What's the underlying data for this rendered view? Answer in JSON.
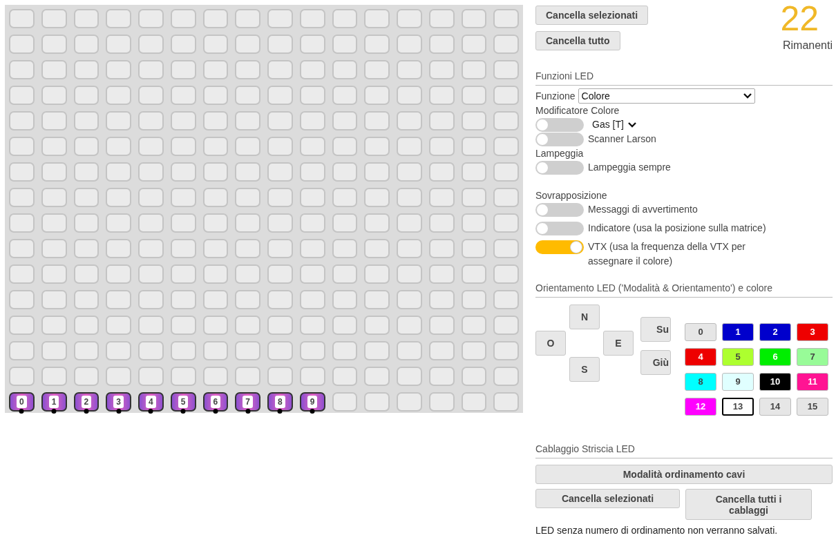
{
  "wired_leds": [
    "0",
    "1",
    "2",
    "3",
    "4",
    "5",
    "6",
    "7",
    "8",
    "9"
  ],
  "top_buttons": [
    "Cancella selezionati",
    "Cancella tutto"
  ],
  "remaining": {
    "count": "22",
    "label": "Rimanenti"
  },
  "functions": {
    "title": "Funzioni LED",
    "function_label": "Funzione",
    "function_value": "Colore",
    "modifier_title": "Modificatore Colore",
    "modifiers": [
      {
        "kind": "select",
        "on": false,
        "label": "Gas [T]"
      },
      {
        "kind": "toggle",
        "on": false,
        "label": "Scanner Larson"
      }
    ],
    "blink_title": "Lampeggia",
    "blink": [
      {
        "on": false,
        "label": "Lampeggia sempre"
      }
    ]
  },
  "overlay": {
    "title": "Sovrapposizione",
    "items": [
      {
        "on": false,
        "label": "Messaggi di avvertimento"
      },
      {
        "on": false,
        "label": "Indicatore (usa la posizione sulla matrice)"
      },
      {
        "on": true,
        "label": "VTX (usa la frequenza della VTX per assegnare il colore)"
      }
    ]
  },
  "orientation": {
    "title": "Orientamento LED ('Modalità & Orientamento') e colore",
    "directions": {
      "north": "N",
      "west": "O",
      "east": "E",
      "south": "S"
    },
    "vertical": [
      "Su",
      "Giù"
    ],
    "colors": [
      {
        "label": "0",
        "color": "#e6e6e6",
        "selected": false
      },
      {
        "label": "1",
        "color": "#0000cc",
        "selected": false
      },
      {
        "label": "2",
        "color": "#0000cc",
        "selected": false
      },
      {
        "label": "3",
        "color": "#ee0000",
        "selected": false
      },
      {
        "label": "4",
        "color": "#ee0000",
        "selected": false
      },
      {
        "label": "5",
        "color": "#adff2f",
        "selected": false
      },
      {
        "label": "6",
        "color": "#00ee00",
        "selected": false
      },
      {
        "label": "7",
        "color": "#98fb98",
        "selected": false
      },
      {
        "label": "8",
        "color": "#00ffff",
        "selected": false
      },
      {
        "label": "9",
        "color": "#e0ffff",
        "selected": false
      },
      {
        "label": "10",
        "color": "#000000",
        "selected": false
      },
      {
        "label": "11",
        "color": "#ff1493",
        "selected": false
      },
      {
        "label": "12",
        "color": "#ff00ff",
        "selected": false
      },
      {
        "label": "13",
        "color": "#ffffff",
        "selected": true
      },
      {
        "label": "14",
        "color": "#e6e6e6",
        "selected": false
      },
      {
        "label": "15",
        "color": "#e6e6e6",
        "selected": false
      }
    ]
  },
  "wiring": {
    "title": "Cablaggio Striscia LED",
    "mode_button": "Modalità ordinamento cavi",
    "buttons": [
      "Cancella selezionati",
      "Cancella tutti i cablaggi"
    ],
    "note": "LED senza numero di ordinamento non verranno salvati."
  }
}
